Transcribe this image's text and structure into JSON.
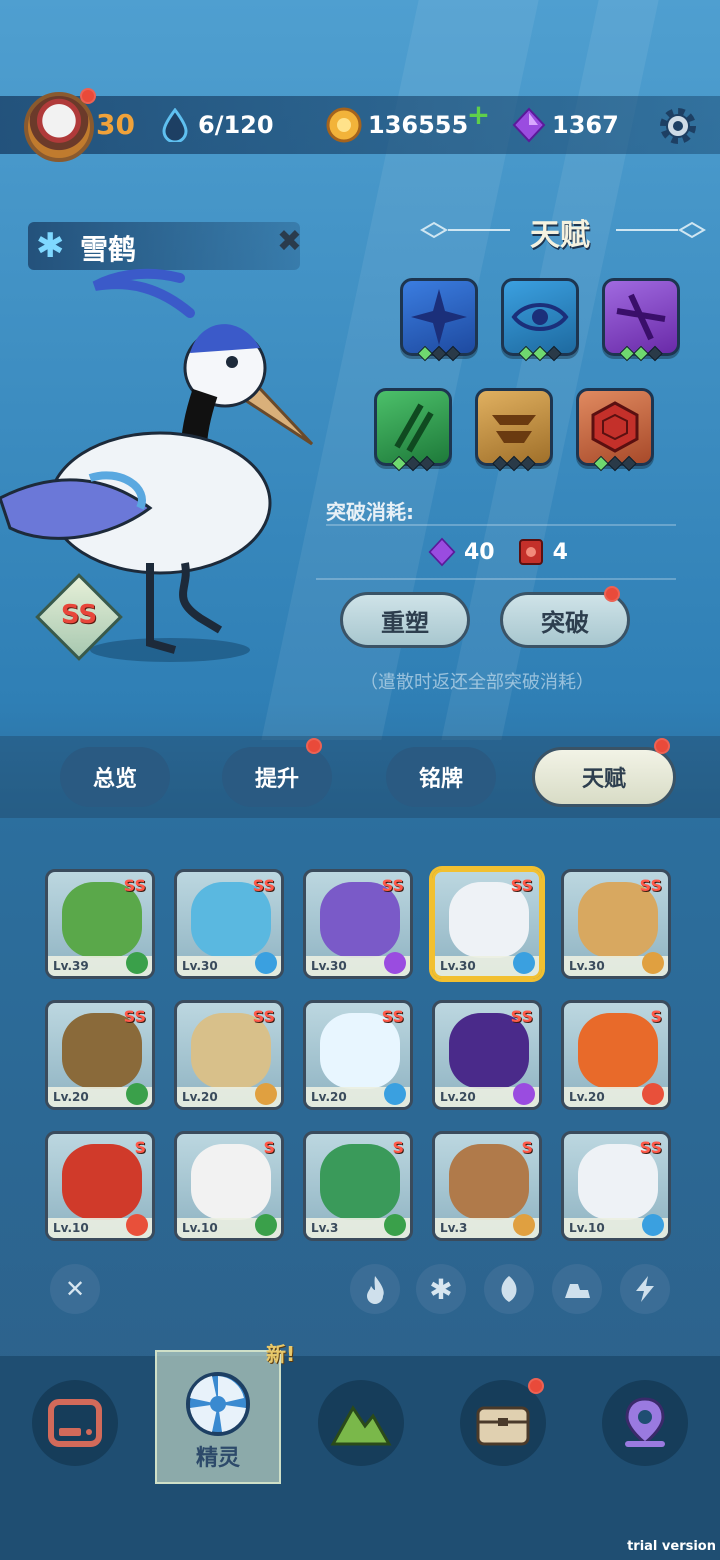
{
  "topbar": {
    "level": "30",
    "stamina": "6/120",
    "coins": "136555",
    "gems": "1367"
  },
  "pet": {
    "name": "雪鹤",
    "grade": "SS"
  },
  "talent": {
    "title": "天赋",
    "cost_label": "突破消耗:",
    "cost_gem": "40",
    "cost_item": "4",
    "reset_label": "重塑",
    "break_label": "突破",
    "note": "（遣散时返还全部突破消耗）"
  },
  "tabs": [
    {
      "label": "总览"
    },
    {
      "label": "提升"
    },
    {
      "label": "铭牌"
    },
    {
      "label": "天赋"
    }
  ],
  "sprites": [
    {
      "level": "Lv.39",
      "grade": "SS"
    },
    {
      "level": "Lv.30",
      "grade": "SS"
    },
    {
      "level": "Lv.30",
      "grade": "SS"
    },
    {
      "level": "Lv.30",
      "grade": "SS"
    },
    {
      "level": "Lv.30",
      "grade": "SS"
    },
    {
      "level": "Lv.20",
      "grade": "SS"
    },
    {
      "level": "Lv.20",
      "grade": "SS"
    },
    {
      "level": "Lv.20",
      "grade": "SS"
    },
    {
      "level": "Lv.20",
      "grade": "SS"
    },
    {
      "level": "Lv.20",
      "grade": "S"
    },
    {
      "level": "Lv.10",
      "grade": "S"
    },
    {
      "level": "Lv.10",
      "grade": "S"
    },
    {
      "level": "Lv.3",
      "grade": "S"
    },
    {
      "level": "Lv.3",
      "grade": "S"
    },
    {
      "level": "Lv.10",
      "grade": "SS"
    }
  ],
  "bottom_nav": {
    "active_label": "精灵",
    "new_label": "新!"
  },
  "watermark": "trial version"
}
